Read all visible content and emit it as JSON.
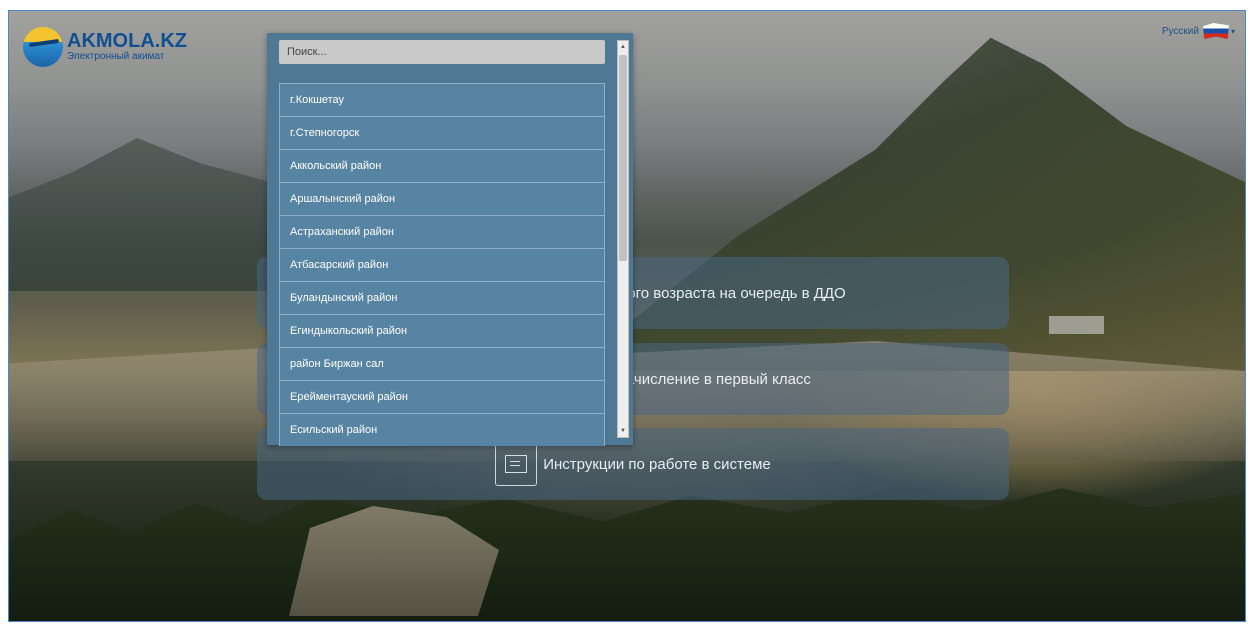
{
  "logo": {
    "title": "AKMOLA.KZ",
    "subtitle": "Электронный акимат"
  },
  "language": {
    "selected": "Русский",
    "flag_icon": "russia-flag-icon"
  },
  "cards": [
    {
      "label": "ного возраста на очередь в ДДО"
    },
    {
      "label": "зачисление в первый класс"
    },
    {
      "label": "Инструкции по работе в системе",
      "icon": "document-icon"
    }
  ],
  "dropdown": {
    "search_placeholder": "Поиск...",
    "items": [
      "г.Кокшетау",
      "г.Степногорск",
      "Аккольский район",
      "Аршалынский район",
      "Астраханский район",
      "Атбасарский район",
      "Буландынский район",
      "Егиндыкольский район",
      "район Биржан сал",
      "Ерейментауский район",
      "Есильский район"
    ]
  },
  "colors": {
    "brand": "#0f4f92",
    "dropdown_bg": "#4f7895",
    "item_bg": "#5884a3"
  }
}
